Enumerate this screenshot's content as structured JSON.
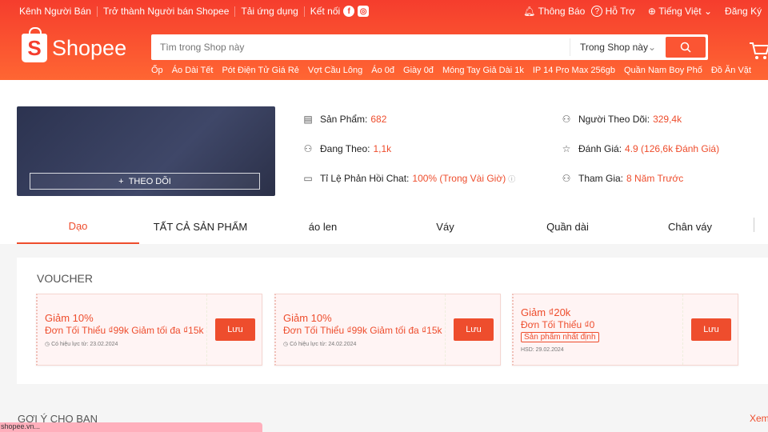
{
  "topbar": {
    "left": [
      "Kênh Người Bán",
      "Trở thành Người bán Shopee",
      "Tải ứng dụng"
    ],
    "connect": "Kết nối",
    "notify": "Thông Báo",
    "help": "Hỗ Trợ",
    "language": "Tiếng Việt",
    "register": "Đăng Ký",
    "login": "Đ"
  },
  "logo": "Shopee",
  "search": {
    "placeholder": "Tìm trong Shop này",
    "scope": "Trong Shop này"
  },
  "quick_links": [
    "Ốp",
    "Áo Dài Tết",
    "Pót Điện Tử Giá Rẻ",
    "Vợt Cầu Lông",
    "Áo 0đ",
    "Giày 0đ",
    "Móng Tay Giả Dài 1k",
    "IP 14 Pro Max 256gb",
    "Quần Nam Boy Phố",
    "Đồ Ăn Vặt"
  ],
  "shop": {
    "follow": "THEO DÕI",
    "stats": [
      {
        "label": "Sản Phẩm:",
        "value": "682"
      },
      {
        "label": "Đang Theo:",
        "value": "1,1k"
      },
      {
        "label": "Tỉ Lệ Phản Hồi Chat:",
        "value": "100% (Trong Vài Giờ)"
      },
      {
        "label": "Người Theo Dõi:",
        "value": "329,4k"
      },
      {
        "label": "Đánh Giá:",
        "value": "4.9 (126,6k Đánh Giá)"
      },
      {
        "label": "Tham Gia:",
        "value": "8 Năm Trước"
      }
    ]
  },
  "tabs": [
    "Dạo",
    "TẤT CẢ SẢN PHẨM",
    "áo len",
    "Váy",
    "Quần dài",
    "Chân váy"
  ],
  "voucher": {
    "title": "VOUCHER",
    "cards": [
      {
        "line1": "Giảm 10%",
        "line2": "Đơn Tối Thiểu ₫99k Giảm tối đa ₫15k",
        "date": "Có hiệu lực từ: 23.02.2024",
        "button": "Lưu"
      },
      {
        "line1": "Giảm 10%",
        "line2": "Đơn Tối Thiểu ₫99k Giảm tối đa ₫15k",
        "date": "Có hiệu lực từ: 24.02.2024",
        "button": "Lưu"
      },
      {
        "line1": "Giảm ₫20k",
        "line2": "Đơn Tối Thiểu ₫0",
        "tag": "Sản phẩm nhất định",
        "date": "HSD: 29.02.2024",
        "button": "Lưu"
      }
    ]
  },
  "suggest": {
    "title": "GỢI Ý CHO BẠN",
    "more": "Xem"
  },
  "status_url": "shopee.vn..."
}
